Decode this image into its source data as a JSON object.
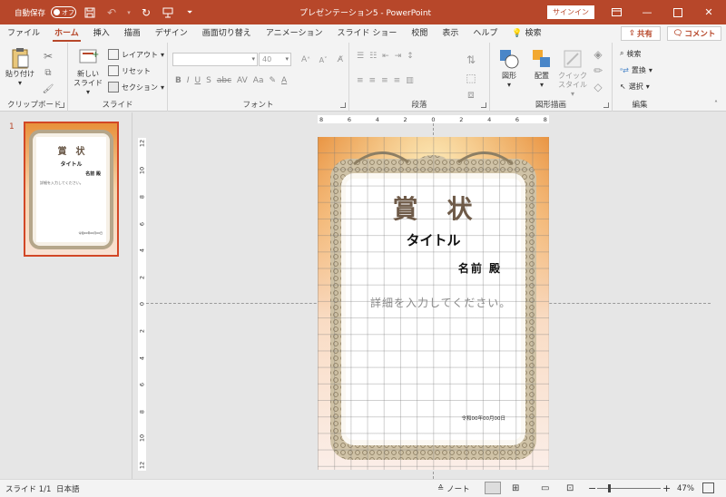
{
  "titlebar": {
    "autosave_label": "自動保存",
    "autosave_state": "オフ",
    "document_title": "プレゼンテーション5  -  PowerPoint",
    "signin_label": "サインイン"
  },
  "tabs": [
    "ファイル",
    "ホーム",
    "挿入",
    "描画",
    "デザイン",
    "画面切り替え",
    "アニメーション",
    "スライド ショー",
    "校閲",
    "表示",
    "ヘルプ"
  ],
  "search_tab": "検索",
  "share_label": "共有",
  "comment_label": "コメント",
  "ribbon": {
    "clipboard": {
      "paste": "貼り付け",
      "label": "クリップボード"
    },
    "slides": {
      "new_slide_1": "新しい",
      "new_slide_2": "スライド",
      "layout": "レイアウト",
      "reset": "リセット",
      "section": "セクション",
      "label": "スライド"
    },
    "font": {
      "size": "40",
      "label": "フォント"
    },
    "paragraph": {
      "label": "段落"
    },
    "drawing": {
      "shapes": "図形",
      "arrange": "配置",
      "quick_styles_1": "クイック",
      "quick_styles_2": "スタイル",
      "label": "図形描画"
    },
    "editing": {
      "find": "検索",
      "replace": "置換",
      "select": "選択",
      "label": "編集"
    }
  },
  "thumbnail": {
    "number": "1",
    "title": "賞　状",
    "subtitle": "タイトル",
    "name": "名前 殿",
    "detail": "詳細を入力してください。",
    "date": "令和00年00月00日"
  },
  "slide": {
    "title": "賞　状",
    "subtitle": "タイトル",
    "name": "名前 殿",
    "detail": "詳細を入力してください。",
    "date": "令和00年00月00日"
  },
  "ruler_h": [
    "8",
    "6",
    "4",
    "2",
    "0",
    "2",
    "4",
    "6",
    "8"
  ],
  "ruler_v": [
    "12",
    "10",
    "8",
    "6",
    "4",
    "2",
    "0",
    "2",
    "4",
    "6",
    "8",
    "10",
    "12"
  ],
  "status": {
    "slide_info": "スライド 1/1",
    "language": "日本語",
    "notes": "ノート",
    "zoom": "47%"
  },
  "colors": {
    "accent": "#b7472a",
    "ribbon_bg": "#f3f3f3",
    "work_bg": "#e6e6e6"
  }
}
